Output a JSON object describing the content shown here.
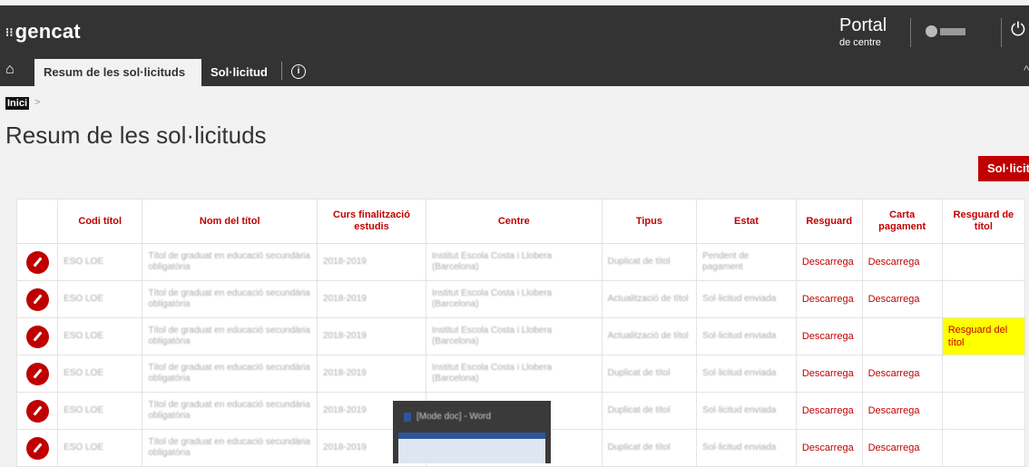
{
  "header": {
    "logo": "gencat",
    "portal_title": "Portal",
    "portal_subtitle": "de centre"
  },
  "tabs": [
    {
      "label": "Resum de les sol·licituds",
      "active": true
    },
    {
      "label": "Sol·licitud",
      "active": false
    }
  ],
  "breadcrumb": {
    "home": "Inici",
    "separator": ">"
  },
  "page": {
    "title": "Resum de les sol·licituds",
    "action_button": "Sol·licita"
  },
  "table": {
    "headers": [
      "",
      "Codi títol",
      "Nom del títol",
      "Curs finalització estudis",
      "Centre",
      "Tipus",
      "Estat",
      "Resguard",
      "Carta pagament",
      "Resguard de títol"
    ],
    "rows": [
      {
        "codi": "ESO LOE",
        "nom": "Títol de graduat en educació secundària obligatòria",
        "curs": "2018-2019",
        "centre": "Institut Escola Costa i Llobera (Barcelona)",
        "tipus": "Duplicat de títol",
        "estat": "Pendent de pagament",
        "resguard": "Descarrega",
        "carta": "Descarrega",
        "resguard_titol": ""
      },
      {
        "codi": "ESO LOE",
        "nom": "Títol de graduat en educació secundària obligatòria",
        "curs": "2018-2019",
        "centre": "Institut Escola Costa i Llobera (Barcelona)",
        "tipus": "Actualització de títol",
        "estat": "Sol·licitud enviada",
        "resguard": "Descarrega",
        "carta": "Descarrega",
        "resguard_titol": ""
      },
      {
        "codi": "ESO LOE",
        "nom": "Títol de graduat en educació secundària obligatòria",
        "curs": "2018-2019",
        "centre": "Institut Escola Costa i Llobera (Barcelona)",
        "tipus": "Actualització de títol",
        "estat": "Sol·licitud enviada",
        "resguard": "Descarrega",
        "carta": "",
        "resguard_titol": "Resguard del títol"
      },
      {
        "codi": "ESO LOE",
        "nom": "Títol de graduat en educació secundària obligatòria",
        "curs": "2018-2019",
        "centre": "Institut Escola Costa i Llobera (Barcelona)",
        "tipus": "Duplicat de títol",
        "estat": "Sol·licitud enviada",
        "resguard": "Descarrega",
        "carta": "Descarrega",
        "resguard_titol": ""
      },
      {
        "codi": "ESO LOE",
        "nom": "Títol de graduat en educació secundària obligatòria",
        "curs": "2018-2019",
        "centre": "",
        "tipus": "Duplicat de títol",
        "estat": "Sol·licitud enviada",
        "resguard": "Descarrega",
        "carta": "Descarrega",
        "resguard_titol": ""
      },
      {
        "codi": "ESO LOE",
        "nom": "Títol de graduat en educació secundària obligatòria",
        "curs": "2018-2019",
        "centre": "",
        "tipus": "Duplicat de títol",
        "estat": "Sol·licitud enviada",
        "resguard": "Descarrega",
        "carta": "Descarrega",
        "resguard_titol": ""
      }
    ]
  },
  "taskbar_preview": {
    "label": "[Mode doc] - Word"
  },
  "colors": {
    "brand": "#c00000",
    "header_bg": "#333333",
    "highlight": "#ffff00"
  },
  "icons": {
    "home": "home-icon",
    "info": "info-icon",
    "power": "power-icon",
    "edit": "pencil-icon"
  }
}
